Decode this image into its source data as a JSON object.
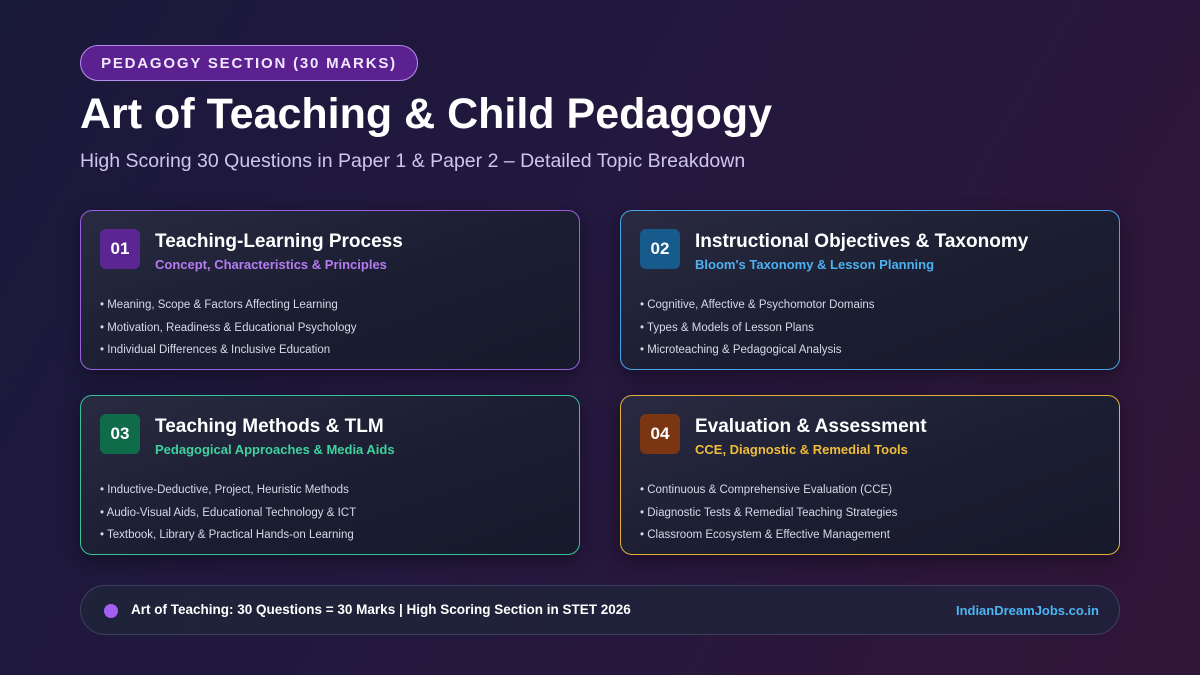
{
  "badge": "PEDAGOGY SECTION (30 MARKS)",
  "title": "Art of Teaching & Child Pedagogy",
  "subtitle": "High Scoring 30 Questions in Paper 1 & Paper 2 – Detailed Topic Breakdown",
  "cards": [
    {
      "number": "01",
      "title": "Teaching-Learning Process",
      "subtitle": "Concept, Characteristics & Principles",
      "accent": "#9c5fe0",
      "items": [
        "• Meaning, Scope & Factors Affecting Learning",
        "• Motivation, Readiness & Educational Psychology",
        "• Individual Differences & Inclusive Education"
      ]
    },
    {
      "number": "02",
      "title": "Instructional Objectives & Taxonomy",
      "subtitle": "Bloom's Taxonomy & Lesson Planning",
      "accent": "#4aa3e8",
      "items": [
        "• Cognitive, Affective & Psychomotor Domains",
        "• Types & Models of Lesson Plans",
        "• Microteaching & Pedagogical Analysis"
      ]
    },
    {
      "number": "03",
      "title": "Teaching Methods & TLM",
      "subtitle": "Pedagogical Approaches & Media Aids",
      "accent": "#35c496",
      "items": [
        "• Inductive-Deductive, Project, Heuristic Methods",
        "• Audio-Visual Aids, Educational Technology & ICT",
        "• Textbook, Library & Practical Hands-on Learning"
      ]
    },
    {
      "number": "04",
      "title": "Evaluation & Assessment",
      "subtitle": "CCE, Diagnostic & Remedial Tools",
      "accent": "#e4b037",
      "items": [
        "• Continuous & Comprehensive Evaluation (CCE)",
        "• Diagnostic Tests & Remedial Teaching Strategies",
        "• Classroom Ecosystem & Effective Management"
      ]
    }
  ],
  "footer": {
    "text": "Art of Teaching: 30 Questions = 30 Marks | High Scoring Section in STET 2026",
    "link": "IndianDreamJobs.co.in"
  }
}
